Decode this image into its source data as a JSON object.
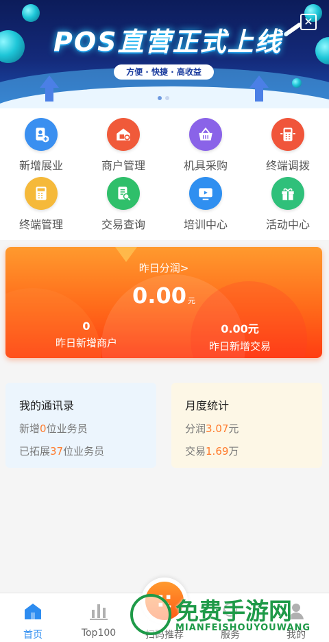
{
  "banner": {
    "title": "POS直营正式上线",
    "subtitle": "方便 · 快捷 · 高收益",
    "close_glyph": "✕"
  },
  "menu": {
    "items": [
      {
        "label": "新增展业",
        "icon": "add-user-icon",
        "color": "#3a8ff0"
      },
      {
        "label": "商户管理",
        "icon": "store-icon",
        "color": "#f05a3a"
      },
      {
        "label": "机具采购",
        "icon": "basket-icon",
        "color": "#8a63e8"
      },
      {
        "label": "终端调拨",
        "icon": "pos-terminal-icon",
        "color": "#f0553a"
      },
      {
        "label": "终端管理",
        "icon": "calculator-icon",
        "color": "#f5b93a"
      },
      {
        "label": "交易查询",
        "icon": "document-search-icon",
        "color": "#2fbf6a"
      },
      {
        "label": "培训中心",
        "icon": "video-play-icon",
        "color": "#2f8ff0"
      },
      {
        "label": "活动中心",
        "icon": "gift-icon",
        "color": "#2fc07a"
      }
    ]
  },
  "earnings": {
    "title": "昨日分润>",
    "amount": "0.00",
    "unit": "元",
    "new_merchants_value": "0",
    "new_merchants_label": "昨日新增商户",
    "new_trades_value": "0.00元",
    "new_trades_label": "昨日新增交易"
  },
  "contacts": {
    "title": "我的通讯录",
    "line1_prefix": "新增",
    "line1_value": "0",
    "line1_suffix": "位业务员",
    "line2_prefix": "已拓展",
    "line2_value": "37",
    "line2_suffix": "位业务员"
  },
  "monthly": {
    "title": "月度统计",
    "line1_prefix": "分润",
    "line1_value": "3.07",
    "line1_suffix": "元",
    "line2_prefix": "交易",
    "line2_value": "1.69",
    "line2_suffix": "万"
  },
  "tabbar": {
    "tabs": [
      {
        "label": "首页",
        "icon": "home-icon"
      },
      {
        "label": "Top100",
        "icon": "bar-chart-icon"
      },
      {
        "label": "扫码推荐",
        "icon": "scan-icon"
      },
      {
        "label": "服务",
        "icon": "service-icon"
      },
      {
        "label": "我的",
        "icon": "user-icon"
      }
    ]
  },
  "watermark": {
    "text": "免费手游网",
    "sub": "MIANFEISHOUYOUWANG"
  },
  "colors": {
    "accent": "#2d8cf0",
    "highlight": "#ff7a2b",
    "card_orange": "#ff6a1a"
  }
}
